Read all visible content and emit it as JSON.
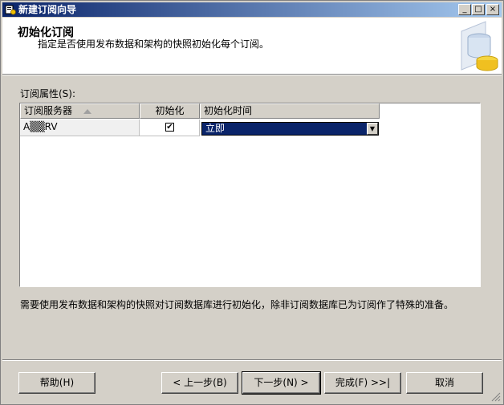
{
  "window": {
    "title": "新建订阅向导",
    "minimize_glyph": "_",
    "maximize_glyph": "□",
    "close_glyph": "×"
  },
  "header": {
    "title": "初始化订阅",
    "description": "指定是否使用发布数据和架构的快照初始化每个订阅。",
    "art_icon": "database-wizard-icon"
  },
  "grid": {
    "label": "订阅属性(S):",
    "columns": [
      {
        "label": "订阅服务器",
        "sorted": "ascending"
      },
      {
        "label": "初始化"
      },
      {
        "label": "初始化时间"
      }
    ],
    "rows": [
      {
        "server": "A▒▒RV",
        "initialize": true,
        "init_time": "立即"
      }
    ]
  },
  "info_text": "需要使用发布数据和架构的快照对订阅数据库进行初始化，除非订阅数据库已为订阅作了特殊的准备。",
  "buttons": {
    "help": "帮助(H)",
    "back": "< 上一步(B)",
    "next": "下一步(N) >",
    "finish": "完成(F) >>|",
    "cancel": "取消"
  },
  "colors": {
    "titlebar_start": "#0a246a",
    "titlebar_end": "#a6caf0",
    "selection": "#0a246a",
    "face": "#d4d0c8"
  }
}
